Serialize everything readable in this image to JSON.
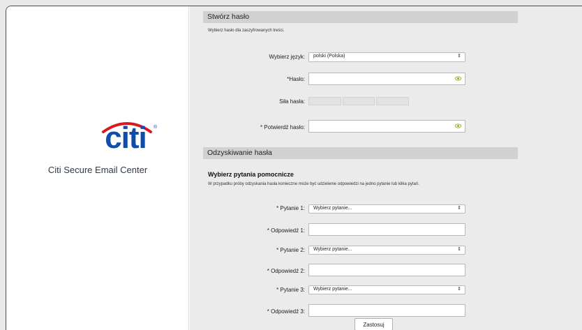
{
  "brand": {
    "logo_text": "citi",
    "registered_mark": "®",
    "center_name": "Citi Secure Email Center",
    "logo_blue": "#0f4da8",
    "arc_red": "#d71920"
  },
  "password_section": {
    "title": "Stwórz hasło",
    "instruction": "Wybierz hasło dla zaszyfrowanych treści.",
    "language_label": "Wybierz język:",
    "language_value": "polski (Polska)",
    "password_label": "*Hasło:",
    "password_value": "",
    "strength_label": "Siła hasła:",
    "strength_segments": 3,
    "confirm_label": "* Potwierdź hasło:",
    "confirm_value": ""
  },
  "recovery_section": {
    "title": "Odzyskiwanie hasła",
    "subheading": "Wybierz pytania pomocnicze",
    "instruction": "W przypadku próby odzyskania hasła konieczne może być udzielenie odpowiedzi na jedno pytanie lub kilka pytań.",
    "question1_label": "* Pytanie 1:",
    "question1_value": "Wybierz pytanie...",
    "answer1_label": "* Odpowiedź 1:",
    "answer1_value": "",
    "question2_label": "* Pytanie 2:",
    "question2_value": "Wybierz pytanie...",
    "answer2_label": "* Odpowiedź 2:",
    "answer2_value": "",
    "question3_label": "* Pytanie 3:",
    "question3_value": "Wybierz pytanie...",
    "answer3_label": "* Odpowiedź 3:",
    "answer3_value": ""
  },
  "submit_label": "Zastosuj"
}
